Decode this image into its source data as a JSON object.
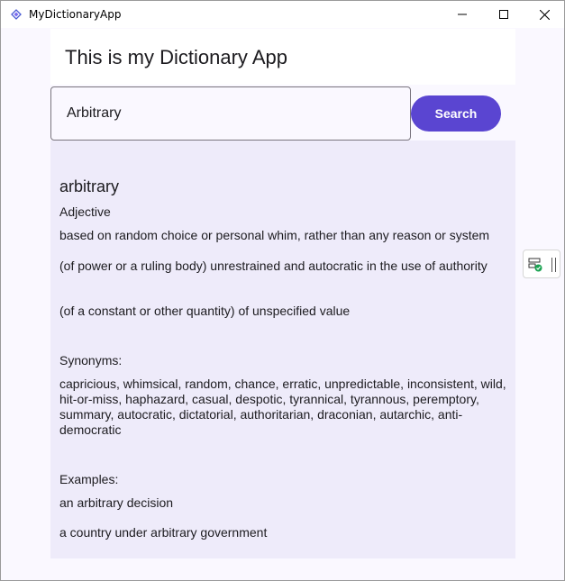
{
  "window": {
    "title": "MyDictionaryApp"
  },
  "header": {
    "title": "This is my Dictionary App"
  },
  "search": {
    "value": "Arbitrary",
    "button_label": "Search"
  },
  "result": {
    "word": "arbitrary",
    "part_of_speech": "Adjective",
    "definitions": [
      "based on random choice or personal whim, rather than any reason or system",
      "(of power or a ruling body) unrestrained and autocratic in the use of authority",
      "(of a constant or other quantity) of unspecified value"
    ],
    "synonyms_heading": "Synonyms:",
    "synonyms": "capricious, whimsical, random, chance, erratic, unpredictable, inconsistent, wild, hit-or-miss, haphazard, casual, despotic, tyrannical, tyrannous, peremptory, summary, autocratic, dictatorial, authoritarian, draconian, autarchic, anti-democratic",
    "examples_heading": "Examples:",
    "examples": [
      "an arbitrary decision",
      "a country under arbitrary government"
    ]
  },
  "icons": {
    "app": "app-logo-icon",
    "minimize": "minimize-icon",
    "maximize": "maximize-icon",
    "close": "close-icon",
    "side_tool": "live-visual-tree-icon"
  },
  "colors": {
    "accent": "#5a45d1",
    "panel": "#eeebfa",
    "background": "#faf8ff"
  }
}
